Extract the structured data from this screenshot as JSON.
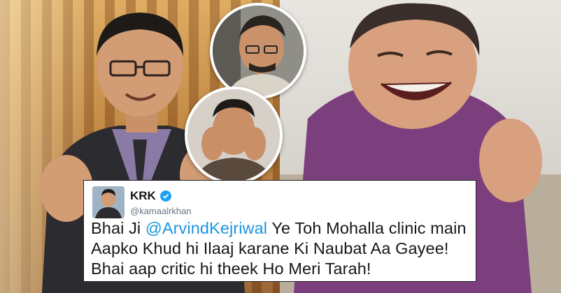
{
  "tweet": {
    "display_name": "KRK",
    "handle": "@kamaalrkhan",
    "text_before": "Bhai Ji ",
    "mention": "@ArvindKejriwal",
    "text_after": " Ye Toh Mohalla clinic main Aapko Khud hi Ilaaj karane Ki Naubat Aa Gayee! Bhai aap critic hi theek Ho Meri Tarah!",
    "verified_color": "#1da1f2",
    "mention_color": "#1b95e0"
  },
  "images": {
    "left_photo": "man-in-suit-gesturing",
    "right_photo": "smiling-man-in-purple-shirt",
    "inset_top": "man-in-car-portrait",
    "inset_bottom": "man-with-hands-on-cheeks"
  }
}
